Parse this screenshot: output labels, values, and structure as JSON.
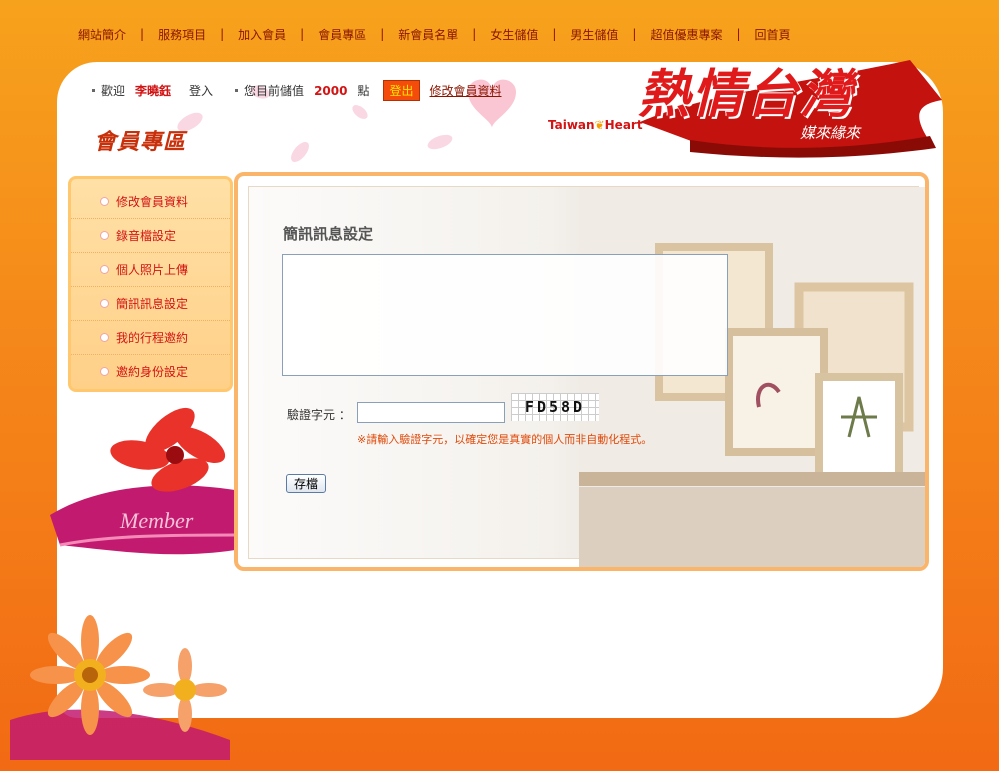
{
  "topnav": [
    {
      "label": "網站簡介"
    },
    {
      "label": "服務項目"
    },
    {
      "label": "加入會員"
    },
    {
      "label": "會員專區"
    },
    {
      "label": "新會員名單"
    },
    {
      "label": "女生儲值"
    },
    {
      "label": "男生儲值"
    },
    {
      "label": "超值優惠專案"
    },
    {
      "label": "回首頁"
    }
  ],
  "userbar": {
    "welcome": "歡迎",
    "username": "李曉鈺",
    "login": "登入",
    "balance_label": "您目前儲值",
    "balance": "2000",
    "unit": "點",
    "logout": "登出",
    "edit_profile": "修改會員資料"
  },
  "section_title": "會員專區",
  "brand": {
    "english_prefix": "Taiwan",
    "english_suffix": "Heart",
    "chinese": "熱情台灣",
    "slogan": "媒來緣來"
  },
  "sidemenu": [
    {
      "label": "修改會員資料"
    },
    {
      "label": "錄音檔設定"
    },
    {
      "label": "個人照片上傳"
    },
    {
      "label": "簡訊訊息設定"
    },
    {
      "label": "我的行程邀約"
    },
    {
      "label": "邀約身份設定"
    }
  ],
  "decor": {
    "member_text": "Member"
  },
  "panel": {
    "title": "簡訊訊息設定",
    "message_value": "",
    "verify_label": "驗證字元 ：",
    "verify_value": "",
    "captcha": "FD58D",
    "verify_note": "※請輸入驗證字元，以確定您是真實的個人而非自動化程式。",
    "save_label": "存檔"
  },
  "colors": {
    "accent": "#f58a1a",
    "brand_red": "#e01a1a",
    "link": "#8a1500"
  }
}
